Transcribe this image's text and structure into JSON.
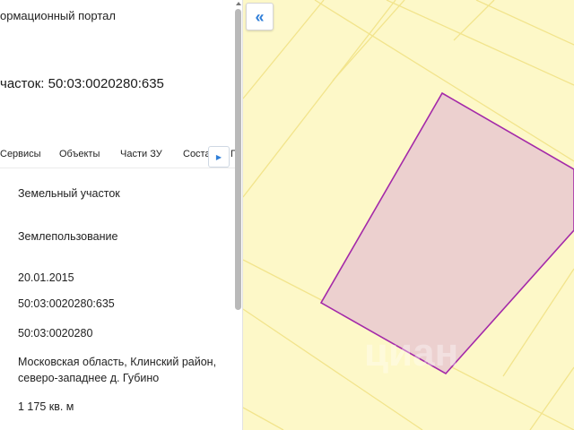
{
  "header": {
    "portal_title": "ормационный портал",
    "parcel_title": "часток: 50:03:0020280:635"
  },
  "tabs": [
    {
      "label": "Сервисы"
    },
    {
      "label": "Объекты"
    },
    {
      "label": "Части ЗУ"
    },
    {
      "label": "Соста"
    },
    {
      "label": "П"
    }
  ],
  "tab_scroll_icon": "chevron-right-icon",
  "fields": {
    "type": "Земельный участок",
    "usage": "Землепользование",
    "date": "20.01.2015",
    "cadastral_number": "50:03:0020280:635",
    "quarter": "50:03:0020280",
    "address": "Московская область, Клинский район, северо-западнее д. Губино",
    "area": "1 175 кв. м"
  },
  "map": {
    "collapse_icon": "double-chevron-left-icon",
    "collapse_label": "«",
    "watermark": "циан",
    "colors": {
      "background": "#fdf8c8",
      "parcel_fill": "#ecd0cf",
      "parcel_stroke": "#a42aa9",
      "boundary_lines": "#f2e48c",
      "accent": "#2f7ed8"
    }
  }
}
